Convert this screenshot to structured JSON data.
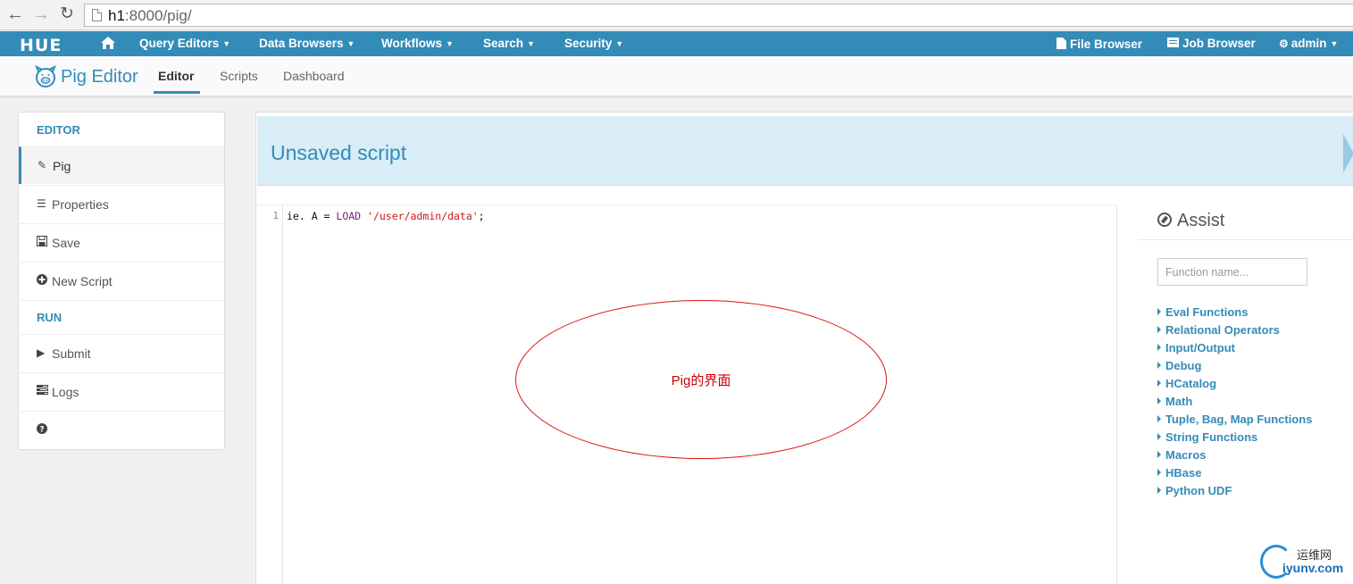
{
  "browser": {
    "url_host": "h1",
    "url_rest": ":8000/pig/"
  },
  "hue_nav": {
    "logo": "HUE",
    "items": [
      {
        "label": "Query Editors"
      },
      {
        "label": "Data Browsers"
      },
      {
        "label": "Workflows"
      },
      {
        "label": "Search"
      },
      {
        "label": "Security"
      }
    ],
    "right": {
      "file_browser": "File Browser",
      "job_browser": "Job Browser",
      "user": "admin"
    }
  },
  "app": {
    "title": "Pig Editor",
    "tabs": {
      "editor": "Editor",
      "scripts": "Scripts",
      "dashboard": "Dashboard"
    }
  },
  "sidebar": {
    "editor_header": "EDITOR",
    "run_header": "RUN",
    "items": {
      "pig": "Pig",
      "properties": "Properties",
      "save": "Save",
      "new_script": "New Script",
      "submit": "Submit",
      "logs": "Logs"
    }
  },
  "main": {
    "script_title": "Unsaved script",
    "code": {
      "line_number": "1",
      "prefix": "ie. A = ",
      "keyword": "LOAD",
      "space": " ",
      "string": "'/user/admin/data'",
      "suffix": ";"
    },
    "annotation": "Pig的界面"
  },
  "assist": {
    "title": "Assist",
    "search_placeholder": "Function name...",
    "items": [
      "Eval Functions",
      "Relational Operators",
      "Input/Output",
      "Debug",
      "HCatalog",
      "Math",
      "Tuple, Bag, Map Functions",
      "String Functions",
      "Macros",
      "HBase",
      "Python UDF"
    ]
  },
  "watermark": {
    "cn": "运维网",
    "en": "iyunv.com"
  },
  "colors": {
    "brand": "#338bb8",
    "header_bg": "#d9edf7",
    "annotation": "#cc0000"
  }
}
